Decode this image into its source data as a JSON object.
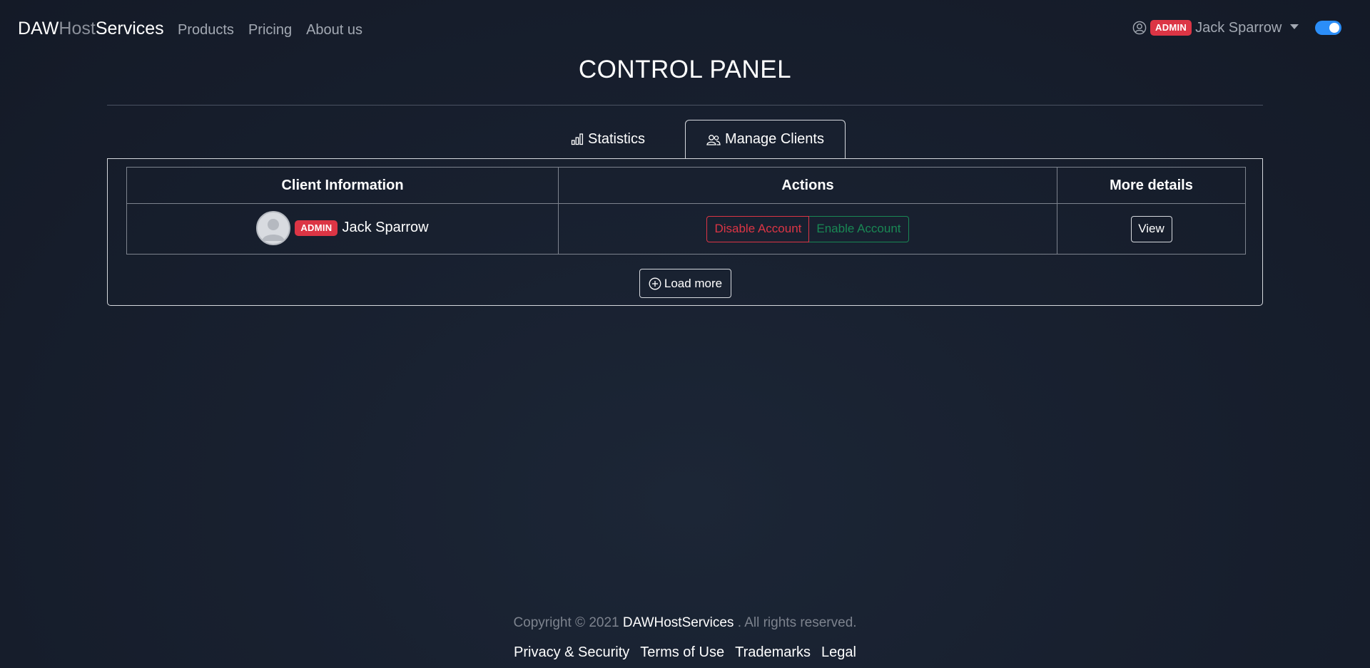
{
  "navbar": {
    "brand": {
      "part1": "DAW",
      "part2": "Host",
      "part3": "Services"
    },
    "links": [
      "Products",
      "Pricing",
      "About us"
    ],
    "user": {
      "icon": "person-circle-icon",
      "badge": "ADMIN",
      "name": "Jack Sparrow"
    },
    "theme_toggle_on": true
  },
  "page": {
    "title": "CONTROL PANEL"
  },
  "tabs": [
    {
      "label": "Statistics",
      "icon": "bar-chart-icon",
      "active": false
    },
    {
      "label": "Manage Clients",
      "icon": "people-icon",
      "active": true
    }
  ],
  "table": {
    "headers": [
      "Client Information",
      "Actions",
      "More details"
    ],
    "rows": [
      {
        "badge": "ADMIN",
        "name": "Jack Sparrow",
        "disable_label": "Disable Account",
        "enable_label": "Enable Account",
        "view_label": "View"
      }
    ]
  },
  "load_more": {
    "label": "Load more",
    "icon": "plus-circle-icon"
  },
  "footer": {
    "copyright_prefix": "Copyright © 2021",
    "copyright_brand": "DAWHostServices",
    "copyright_suffix": ". All rights reserved.",
    "links": [
      "Privacy & Security",
      "Terms of Use",
      "Trademarks",
      "Legal"
    ]
  },
  "colors": {
    "accent_blue": "#2b8ef8",
    "danger": "#dc3545",
    "success": "#198754",
    "background": "#18202f"
  }
}
